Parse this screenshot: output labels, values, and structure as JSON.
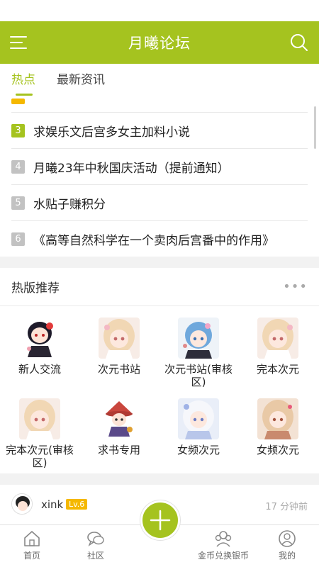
{
  "app": {
    "title": "月曦论坛"
  },
  "colors": {
    "brand": "#a5c31f",
    "num_hot": "#a5c31f",
    "num_normal": "#c2c2c2",
    "level_badge": "#f5b800"
  },
  "tabs": [
    {
      "label": "热点",
      "active": true
    },
    {
      "label": "最新资讯",
      "active": false
    }
  ],
  "hot_list": [
    {
      "num": "3",
      "title": "求娱乐文后宫多女主加料小说"
    },
    {
      "num": "4",
      "title": "月曦23年中秋国庆活动（提前通知）"
    },
    {
      "num": "5",
      "title": "水贴子赚积分"
    },
    {
      "num": "6",
      "title": "《高等自然科学在一个卖肉后宫番中的作用》"
    }
  ],
  "hot_boards": {
    "title": "热版推荐",
    "more": "•••",
    "boards": [
      {
        "name": "新人交流",
        "icon": "chibi-girl-icon"
      },
      {
        "name": "次元书站",
        "icon": "anime-girl-icon"
      },
      {
        "name": "次元书站(审核区)",
        "icon": "blue-hair-girl-icon"
      },
      {
        "name": "完本次元",
        "icon": "anime-girl-icon"
      },
      {
        "name": "完本次元(审核区)",
        "icon": "anime-girl-icon"
      },
      {
        "name": "求书专用",
        "icon": "witch-girl-icon"
      },
      {
        "name": "女频次元",
        "icon": "white-hair-girl-icon"
      },
      {
        "name": "女频次元",
        "icon": "anime-girl-icon"
      }
    ]
  },
  "post": {
    "username": "xink",
    "level": "Lv.6",
    "time": "17 分钟前"
  },
  "bottom_nav": [
    {
      "label": "首页",
      "icon": "home-icon"
    },
    {
      "label": "社区",
      "icon": "chat-icon"
    },
    {
      "label": "金币兑换银币",
      "icon": "exchange-icon"
    },
    {
      "label": "我的",
      "icon": "profile-icon"
    }
  ]
}
